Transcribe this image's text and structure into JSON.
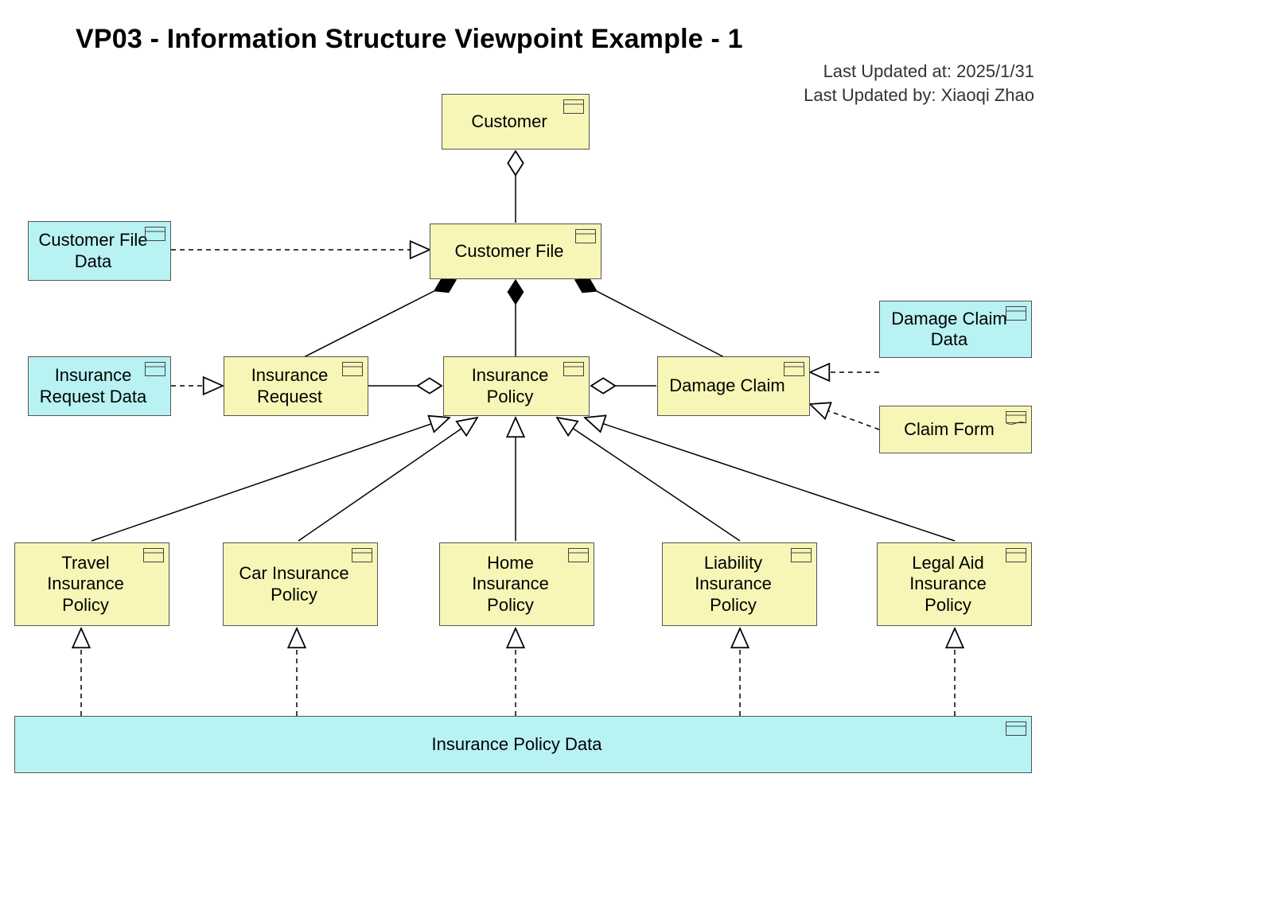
{
  "title": "VP03 - Information Structure Viewpoint Example - 1",
  "meta": {
    "updated_at_label": "Last Updated at: 2025/1/31",
    "updated_by_label": "Last Updated by: Xiaoqi Zhao"
  },
  "nodes": {
    "customer": {
      "label": "Customer",
      "type": "bo"
    },
    "customer_file": {
      "label": "Customer File",
      "type": "bo"
    },
    "customer_file_data": {
      "label": "Customer File Data",
      "type": "do"
    },
    "insurance_request": {
      "label": "Insurance Request",
      "type": "bo"
    },
    "ins_request_data": {
      "label": "Insurance Request Data",
      "type": "do"
    },
    "insurance_policy": {
      "label": "Insurance Policy",
      "type": "bo"
    },
    "damage_claim": {
      "label": "Damage Claim",
      "type": "bo"
    },
    "damage_claim_data": {
      "label": "Damage Claim Data",
      "type": "do"
    },
    "claim_form": {
      "label": "Claim Form",
      "type": "rep"
    },
    "travel_policy": {
      "label": "Travel Insurance Policy",
      "type": "bo"
    },
    "car_policy": {
      "label": "Car Insurance Policy",
      "type": "bo"
    },
    "home_policy": {
      "label": "Home Insurance Policy",
      "type": "bo"
    },
    "liability_policy": {
      "label": "Liability Insurance Policy",
      "type": "bo"
    },
    "legal_policy": {
      "label": "Legal Aid Insurance Policy",
      "type": "bo"
    },
    "ins_policy_data": {
      "label": "Insurance Policy Data",
      "type": "do"
    }
  },
  "relations": [
    {
      "from": "customer_file",
      "to": "customer",
      "type": "aggregation-open"
    },
    {
      "from": "customer_file_data",
      "to": "customer_file",
      "type": "realization"
    },
    {
      "from": "insurance_request",
      "to": "customer_file",
      "type": "composition"
    },
    {
      "from": "insurance_policy",
      "to": "customer_file",
      "type": "composition"
    },
    {
      "from": "damage_claim",
      "to": "customer_file",
      "type": "composition"
    },
    {
      "from": "ins_request_data",
      "to": "insurance_request",
      "type": "realization"
    },
    {
      "from": "insurance_request",
      "to": "insurance_policy",
      "type": "aggregation-open"
    },
    {
      "from": "damage_claim",
      "to": "insurance_policy",
      "type": "aggregation-open"
    },
    {
      "from": "damage_claim_data",
      "to": "damage_claim",
      "type": "realization"
    },
    {
      "from": "claim_form",
      "to": "damage_claim",
      "type": "realization"
    },
    {
      "from": "travel_policy",
      "to": "insurance_policy",
      "type": "specialization"
    },
    {
      "from": "car_policy",
      "to": "insurance_policy",
      "type": "specialization"
    },
    {
      "from": "home_policy",
      "to": "insurance_policy",
      "type": "specialization"
    },
    {
      "from": "liability_policy",
      "to": "insurance_policy",
      "type": "specialization"
    },
    {
      "from": "legal_policy",
      "to": "insurance_policy",
      "type": "specialization"
    },
    {
      "from": "ins_policy_data",
      "to": "travel_policy",
      "type": "realization"
    },
    {
      "from": "ins_policy_data",
      "to": "car_policy",
      "type": "realization"
    },
    {
      "from": "ins_policy_data",
      "to": "home_policy",
      "type": "realization"
    },
    {
      "from": "ins_policy_data",
      "to": "liability_policy",
      "type": "realization"
    },
    {
      "from": "ins_policy_data",
      "to": "legal_policy",
      "type": "realization"
    }
  ]
}
